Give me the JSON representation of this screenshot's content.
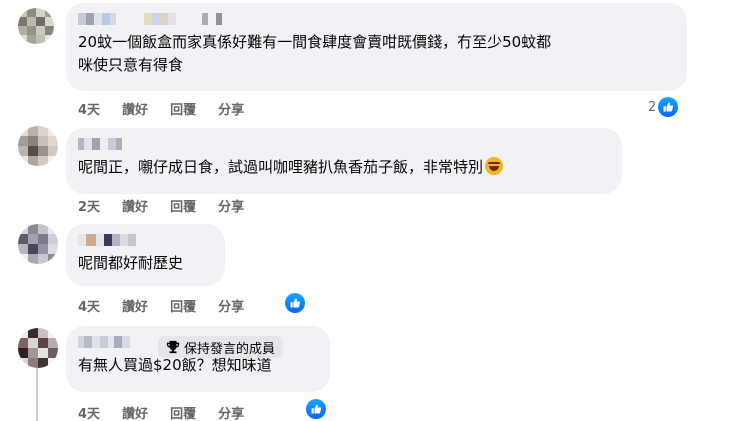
{
  "comments": [
    {
      "text_lines": [
        "20蚊一個飯盒而家真係好難有一間食肆度會賣咁既價錢，冇至少50蚊都",
        "咪使只意有得食"
      ],
      "time": "4天",
      "like_label": "讚好",
      "reply_label": "回覆",
      "share_label": "分享",
      "reaction_count": "2"
    },
    {
      "text": "呢間正，嚫仔成日食，試過叫咖哩豬扒魚香茄子飯，非常特別",
      "emoji": "rofl-emoji",
      "time": "2天",
      "like_label": "讚好",
      "reply_label": "回覆",
      "share_label": "分享"
    },
    {
      "text": "呢間都好耐歷史",
      "time": "4天",
      "like_label": "讚好",
      "reply_label": "回覆",
      "share_label": "分享",
      "reaction": "like-icon"
    },
    {
      "badge_label": "保持發言的成員",
      "badge_icon": "trophy-icon",
      "text": "有無人買過$20飯？想知味道",
      "time": "4天",
      "like_label": "讚好",
      "reply_label": "回覆",
      "share_label": "分享",
      "reaction": "like-icon"
    }
  ],
  "colors": {
    "bubble": "#f0f2f5",
    "meta_text": "#65676b",
    "like_blue": "#0866ff",
    "badge_bg": "#e4e6eb"
  }
}
